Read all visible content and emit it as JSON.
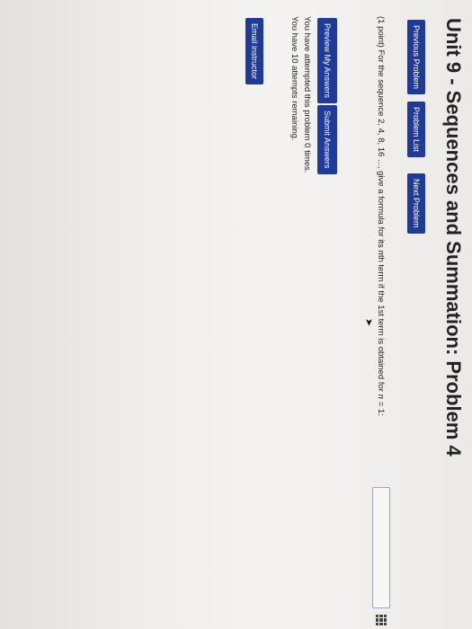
{
  "page": {
    "title": "Unit 9 - Sequences and Summation: Problem 4"
  },
  "nav": {
    "previous_label": "Previous Problem",
    "list_label": "Problem List",
    "next_label": "Next Problem"
  },
  "problem": {
    "points": "(1 point)",
    "text_before": "For the sequence 2, 4, 8, 16 ..., give a formula for its ",
    "nth": "n",
    "text_mid": "th term if the 1st term is obtained for ",
    "n_var": "n",
    "text_after": " = 1:",
    "answer_value": "",
    "answer_placeholder": ""
  },
  "actions": {
    "preview_label": "Preview My Answers",
    "submit_label": "Submit Answers"
  },
  "status": {
    "attempted": "You have attempted this problem 0 times.",
    "remaining": "You have 10 attempts remaining."
  },
  "footer": {
    "email_label": "Email instructor"
  },
  "icons": {
    "grid": "grid-icon",
    "pointer": "pointer-icon"
  },
  "colors": {
    "button_bg": "#1f3b97",
    "button_text": "#ffffff"
  }
}
